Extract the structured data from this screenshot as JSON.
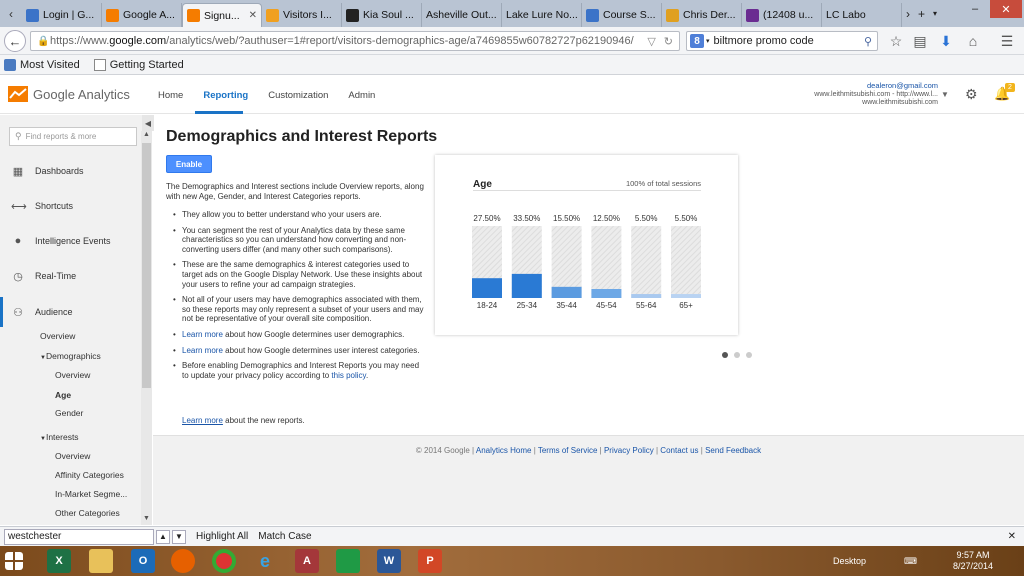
{
  "browser": {
    "tabs": [
      {
        "label": "Login | G...",
        "color": "#3b73c8"
      },
      {
        "label": "Google A...",
        "color": "#f57c00"
      },
      {
        "label": "Signu...",
        "color": "#f57c00",
        "active": true
      },
      {
        "label": "Visitors I...",
        "color": "#f0a020"
      },
      {
        "label": "Kia Soul ...",
        "color": "#222222"
      },
      {
        "label": "Asheville Out...",
        "color": ""
      },
      {
        "label": "Lake Lure No...",
        "color": ""
      },
      {
        "label": "Course S...",
        "color": "#3b73c8"
      },
      {
        "label": "Chris Der...",
        "color": "#e0a020"
      },
      {
        "label": "(12408 u...",
        "color": "#6a2c91"
      },
      {
        "label": "LC Labo",
        "color": ""
      }
    ],
    "url_prefix": "https://www.",
    "url_host": "google.com",
    "url_rest": "/analytics/web/?authuser=1#report/visitors-demographics-age/a7469855w60782727p62190946/",
    "search_text": "biltmore promo code",
    "bookmarks": [
      "Most Visited",
      "Getting Started"
    ]
  },
  "ga": {
    "logo_text": "Google Analytics",
    "nav": [
      "Home",
      "Reporting",
      "Customization",
      "Admin"
    ],
    "account_email": "dealeron@gmail.com",
    "account_line2": "www.leithmitsubishi.com - http://www.l...",
    "account_line3": "www.leithmitsubishi.com",
    "notification_count": "2"
  },
  "sidebar": {
    "search_placeholder": "Find reports & more",
    "items": [
      {
        "label": "Dashboards",
        "icon": "grid-icon"
      },
      {
        "label": "Shortcuts",
        "icon": "arrows-icon"
      },
      {
        "label": "Intelligence Events",
        "icon": "bulb-icon"
      },
      {
        "label": "Real-Time",
        "icon": "clock-icon"
      },
      {
        "label": "Audience",
        "icon": "people-icon"
      }
    ],
    "sub": {
      "overview": "Overview",
      "demographics": "Demographics",
      "demo_overview": "Overview",
      "age": "Age",
      "gender": "Gender",
      "interests": "Interests",
      "int_overview": "Overview",
      "affinity": "Affinity Categories",
      "inmarket": "In-Market Segme...",
      "other": "Other Categories"
    }
  },
  "main": {
    "title": "Demographics and Interest Reports",
    "enable_label": "Enable",
    "intro": "The Demographics and Interest sections include Overview reports, along with new Age, Gender, and Interest Categories reports.",
    "bullets": [
      "They allow you to better understand who your users are.",
      "You can segment the rest of your Analytics data by these same characteristics so you can understand how converting and non-converting users differ (and many other such comparisons).",
      "These are the same demographics & interest categories used to target ads on the Google Display Network. Use these insights about your users to refine your ad campaign strategies.",
      "Not all of your users may have demographics associated with them, so these reports may only represent a subset of your users and may not be representative of your overall site composition."
    ],
    "learn1_link": "Learn more",
    "learn1_rest": " about how Google determines user demographics.",
    "learn2_link": "Learn more",
    "learn2_rest": " about how Google determines user interest categories.",
    "policy_text": "Before enabling Demographics and Interest Reports you may need to update your privacy policy according to ",
    "policy_link": "this policy",
    "policy_end": ".",
    "learn3_link": "Learn more",
    "learn3_rest": " about the new reports."
  },
  "chart_data": {
    "type": "bar",
    "title": "Age",
    "subtitle": "100% of total sessions",
    "categories": [
      "18-24",
      "25-34",
      "35-44",
      "45-54",
      "55-64",
      "65+"
    ],
    "values": [
      27.5,
      33.5,
      15.5,
      12.5,
      5.5,
      5.5
    ],
    "value_labels": [
      "27.50%",
      "33.50%",
      "15.50%",
      "12.50%",
      "5.50%",
      "5.50%"
    ],
    "ylim": [
      0,
      100
    ],
    "colors": [
      "#2a7ad4",
      "#2a7ad4",
      "#5b9be0",
      "#6da8e6",
      "#a9c9ef",
      "#b9d3f2"
    ]
  },
  "carousel": {
    "count": 3,
    "active": 0
  },
  "footer": {
    "copyright": "© 2014 Google | ",
    "links": [
      "Analytics Home",
      "Terms of Service",
      "Privacy Policy",
      "Contact us",
      "Send Feedback"
    ]
  },
  "findbar": {
    "value": "westchester",
    "highlight_label": "Highlight All",
    "match_case_label": "Match Case"
  },
  "taskbar": {
    "desktop_label": "Desktop",
    "time": "9:57 AM",
    "date": "8/27/2014"
  }
}
